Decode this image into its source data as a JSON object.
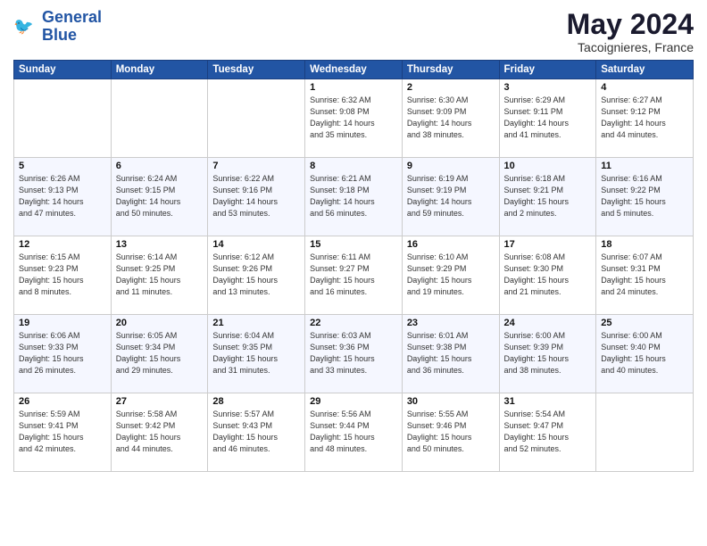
{
  "header": {
    "logo_line1": "General",
    "logo_line2": "Blue",
    "month_year": "May 2024",
    "location": "Tacoignieres, France"
  },
  "weekdays": [
    "Sunday",
    "Monday",
    "Tuesday",
    "Wednesday",
    "Thursday",
    "Friday",
    "Saturday"
  ],
  "weeks": [
    [
      {
        "day": "",
        "info": ""
      },
      {
        "day": "",
        "info": ""
      },
      {
        "day": "",
        "info": ""
      },
      {
        "day": "1",
        "info": "Sunrise: 6:32 AM\nSunset: 9:08 PM\nDaylight: 14 hours\nand 35 minutes."
      },
      {
        "day": "2",
        "info": "Sunrise: 6:30 AM\nSunset: 9:09 PM\nDaylight: 14 hours\nand 38 minutes."
      },
      {
        "day": "3",
        "info": "Sunrise: 6:29 AM\nSunset: 9:11 PM\nDaylight: 14 hours\nand 41 minutes."
      },
      {
        "day": "4",
        "info": "Sunrise: 6:27 AM\nSunset: 9:12 PM\nDaylight: 14 hours\nand 44 minutes."
      }
    ],
    [
      {
        "day": "5",
        "info": "Sunrise: 6:26 AM\nSunset: 9:13 PM\nDaylight: 14 hours\nand 47 minutes."
      },
      {
        "day": "6",
        "info": "Sunrise: 6:24 AM\nSunset: 9:15 PM\nDaylight: 14 hours\nand 50 minutes."
      },
      {
        "day": "7",
        "info": "Sunrise: 6:22 AM\nSunset: 9:16 PM\nDaylight: 14 hours\nand 53 minutes."
      },
      {
        "day": "8",
        "info": "Sunrise: 6:21 AM\nSunset: 9:18 PM\nDaylight: 14 hours\nand 56 minutes."
      },
      {
        "day": "9",
        "info": "Sunrise: 6:19 AM\nSunset: 9:19 PM\nDaylight: 14 hours\nand 59 minutes."
      },
      {
        "day": "10",
        "info": "Sunrise: 6:18 AM\nSunset: 9:21 PM\nDaylight: 15 hours\nand 2 minutes."
      },
      {
        "day": "11",
        "info": "Sunrise: 6:16 AM\nSunset: 9:22 PM\nDaylight: 15 hours\nand 5 minutes."
      }
    ],
    [
      {
        "day": "12",
        "info": "Sunrise: 6:15 AM\nSunset: 9:23 PM\nDaylight: 15 hours\nand 8 minutes."
      },
      {
        "day": "13",
        "info": "Sunrise: 6:14 AM\nSunset: 9:25 PM\nDaylight: 15 hours\nand 11 minutes."
      },
      {
        "day": "14",
        "info": "Sunrise: 6:12 AM\nSunset: 9:26 PM\nDaylight: 15 hours\nand 13 minutes."
      },
      {
        "day": "15",
        "info": "Sunrise: 6:11 AM\nSunset: 9:27 PM\nDaylight: 15 hours\nand 16 minutes."
      },
      {
        "day": "16",
        "info": "Sunrise: 6:10 AM\nSunset: 9:29 PM\nDaylight: 15 hours\nand 19 minutes."
      },
      {
        "day": "17",
        "info": "Sunrise: 6:08 AM\nSunset: 9:30 PM\nDaylight: 15 hours\nand 21 minutes."
      },
      {
        "day": "18",
        "info": "Sunrise: 6:07 AM\nSunset: 9:31 PM\nDaylight: 15 hours\nand 24 minutes."
      }
    ],
    [
      {
        "day": "19",
        "info": "Sunrise: 6:06 AM\nSunset: 9:33 PM\nDaylight: 15 hours\nand 26 minutes."
      },
      {
        "day": "20",
        "info": "Sunrise: 6:05 AM\nSunset: 9:34 PM\nDaylight: 15 hours\nand 29 minutes."
      },
      {
        "day": "21",
        "info": "Sunrise: 6:04 AM\nSunset: 9:35 PM\nDaylight: 15 hours\nand 31 minutes."
      },
      {
        "day": "22",
        "info": "Sunrise: 6:03 AM\nSunset: 9:36 PM\nDaylight: 15 hours\nand 33 minutes."
      },
      {
        "day": "23",
        "info": "Sunrise: 6:01 AM\nSunset: 9:38 PM\nDaylight: 15 hours\nand 36 minutes."
      },
      {
        "day": "24",
        "info": "Sunrise: 6:00 AM\nSunset: 9:39 PM\nDaylight: 15 hours\nand 38 minutes."
      },
      {
        "day": "25",
        "info": "Sunrise: 6:00 AM\nSunset: 9:40 PM\nDaylight: 15 hours\nand 40 minutes."
      }
    ],
    [
      {
        "day": "26",
        "info": "Sunrise: 5:59 AM\nSunset: 9:41 PM\nDaylight: 15 hours\nand 42 minutes."
      },
      {
        "day": "27",
        "info": "Sunrise: 5:58 AM\nSunset: 9:42 PM\nDaylight: 15 hours\nand 44 minutes."
      },
      {
        "day": "28",
        "info": "Sunrise: 5:57 AM\nSunset: 9:43 PM\nDaylight: 15 hours\nand 46 minutes."
      },
      {
        "day": "29",
        "info": "Sunrise: 5:56 AM\nSunset: 9:44 PM\nDaylight: 15 hours\nand 48 minutes."
      },
      {
        "day": "30",
        "info": "Sunrise: 5:55 AM\nSunset: 9:46 PM\nDaylight: 15 hours\nand 50 minutes."
      },
      {
        "day": "31",
        "info": "Sunrise: 5:54 AM\nSunset: 9:47 PM\nDaylight: 15 hours\nand 52 minutes."
      },
      {
        "day": "",
        "info": ""
      }
    ]
  ]
}
